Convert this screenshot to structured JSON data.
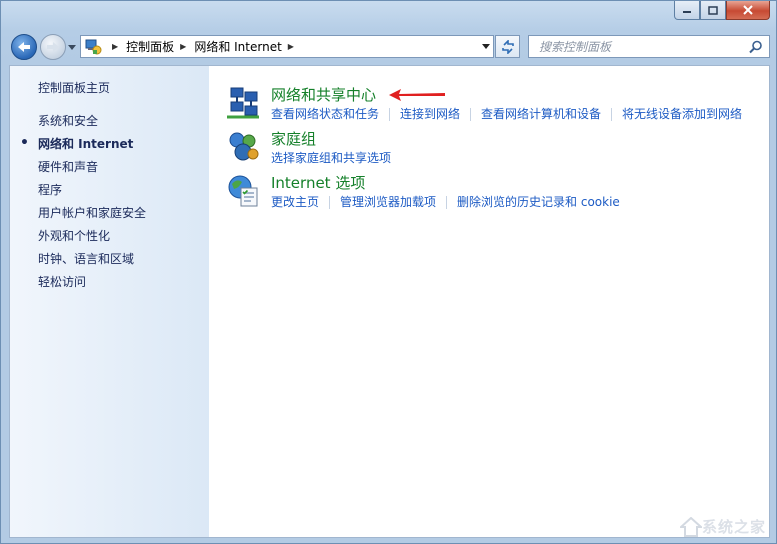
{
  "address": {
    "icon": "control-panel-icon",
    "segments": [
      "控制面板",
      "网络和 Internet"
    ]
  },
  "search": {
    "placeholder": "搜索控制面板"
  },
  "sidebar": {
    "home": "控制面板主页",
    "items": [
      {
        "label": "系统和安全",
        "active": false
      },
      {
        "label": "网络和 Internet",
        "active": true
      },
      {
        "label": "硬件和声音",
        "active": false
      },
      {
        "label": "程序",
        "active": false
      },
      {
        "label": "用户帐户和家庭安全",
        "active": false
      },
      {
        "label": "外观和个性化",
        "active": false
      },
      {
        "label": "时钟、语言和区域",
        "active": false
      },
      {
        "label": "轻松访问",
        "active": false
      }
    ]
  },
  "categories": [
    {
      "title": "网络和共享中心",
      "icon": "network-sharing-center-icon",
      "links": [
        "查看网络状态和任务",
        "连接到网络",
        "查看网络计算机和设备",
        "将无线设备添加到网络"
      ]
    },
    {
      "title": "家庭组",
      "icon": "homegroup-icon",
      "links": [
        "选择家庭组和共享选项"
      ]
    },
    {
      "title": "Internet 选项",
      "icon": "internet-options-icon",
      "links": [
        "更改主页",
        "管理浏览器加载项",
        "删除浏览的历史记录和 cookie"
      ]
    }
  ],
  "annotation": {
    "arrow_color": "#e02020"
  },
  "watermark": {
    "text": "系统之家"
  },
  "colors": {
    "link": "#1d5bc4",
    "category_title": "#15802a",
    "sidebar_text": "#1b2a5a"
  }
}
